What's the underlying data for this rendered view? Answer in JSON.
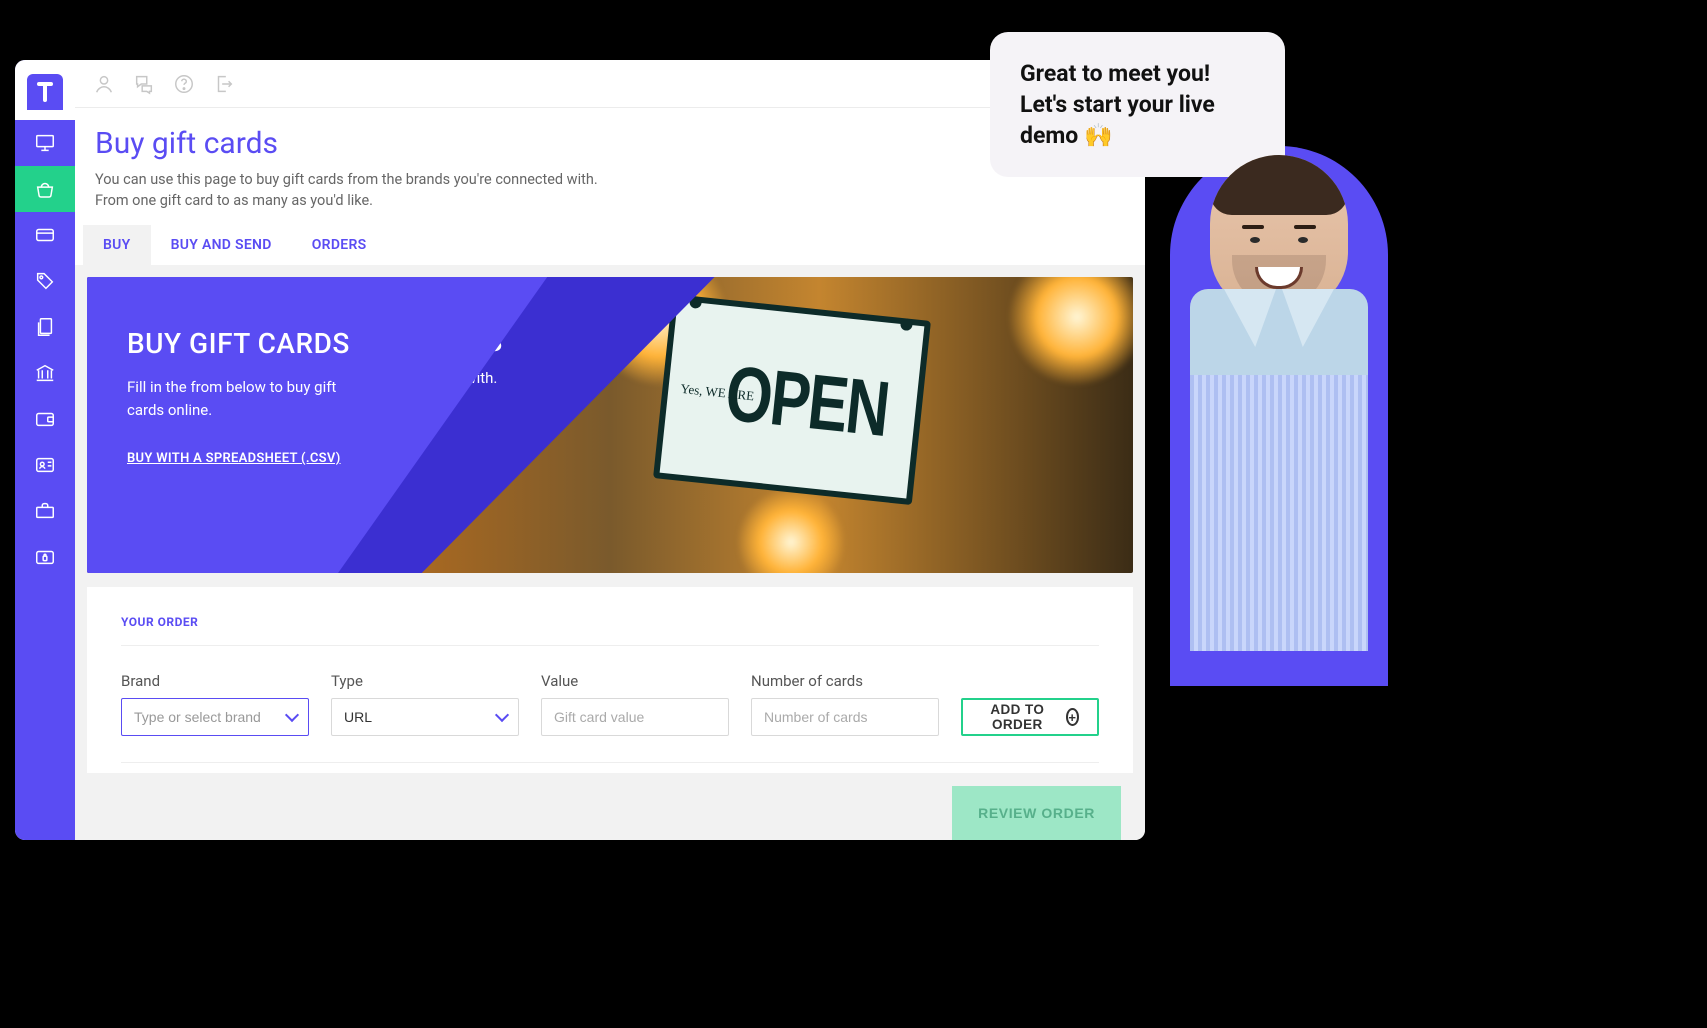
{
  "header": {
    "title": "Buy gift cards",
    "description": "You can use this page to buy gift cards from the brands you're connected with. From one gift card to as many as you'd like."
  },
  "tabs": [
    "BUY",
    "BUY AND SEND",
    "ORDERS"
  ],
  "hero": {
    "title": "BUY GIFT CARDS",
    "subtitle": "Fill in the from below to buy gift cards online.",
    "csv_link": "BUY WITH A SPREADSHEET (.CSV)",
    "ghost_title_fragment": "ANDS",
    "ghost_sub_fragment": "ade with.",
    "sign_small": "Yes,\nWE ARE",
    "sign_big": "OPEN"
  },
  "order": {
    "section_label": "YOUR ORDER",
    "fields": {
      "brand": {
        "label": "Brand",
        "placeholder": "Type or select brand"
      },
      "type": {
        "label": "Type",
        "value": "URL"
      },
      "value": {
        "label": "Value",
        "placeholder": "Gift card value"
      },
      "number": {
        "label": "Number of cards",
        "placeholder": "Number of cards"
      }
    },
    "add_button": "ADD TO ORDER",
    "review_button": "REVIEW ORDER"
  },
  "demo": {
    "bubble_text": "Great to meet you! Let's start your live demo 🙌"
  }
}
